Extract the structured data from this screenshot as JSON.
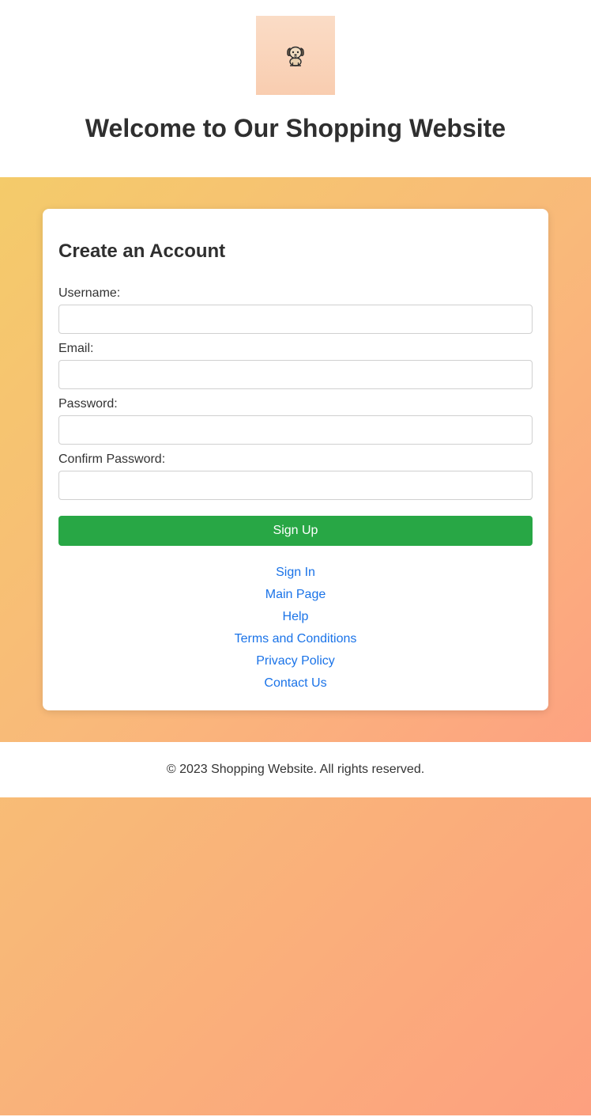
{
  "header": {
    "logo_icon": "puppy-icon",
    "title": "Welcome to Our Shopping Website"
  },
  "form": {
    "title": "Create an Account",
    "fields": [
      {
        "label": "Username:",
        "value": "",
        "placeholder": ""
      },
      {
        "label": "Email:",
        "value": "",
        "placeholder": ""
      },
      {
        "label": "Password:",
        "value": "",
        "placeholder": ""
      },
      {
        "label": "Confirm Password:",
        "value": "",
        "placeholder": ""
      }
    ],
    "submit_label": "Sign Up"
  },
  "links": [
    {
      "label": "Sign In"
    },
    {
      "label": "Main Page"
    },
    {
      "label": "Help"
    },
    {
      "label": "Terms and Conditions"
    },
    {
      "label": "Privacy Policy"
    },
    {
      "label": "Contact Us"
    }
  ],
  "footer": {
    "text": "© 2023 Shopping Website. All rights reserved."
  },
  "colors": {
    "accent_button": "#28a745",
    "link": "#1a73e8",
    "background_start": "#f4d166",
    "background_end": "#fda07f"
  }
}
